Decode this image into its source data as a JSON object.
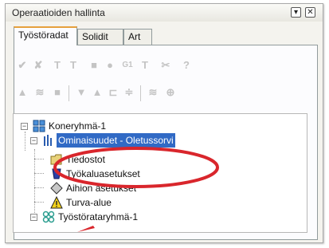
{
  "window": {
    "title": "Operaatioiden hallinta"
  },
  "tabs": [
    {
      "label": "Työstöradat"
    },
    {
      "label": "Solidit"
    },
    {
      "label": "Art"
    }
  ],
  "tree": {
    "group1": {
      "label": "Koneryhmä-1"
    },
    "properties": {
      "label": "Ominaisuudet - Oletussorvi"
    },
    "children": [
      {
        "label": "Tiedostot"
      },
      {
        "label": "Työkaluasetukset"
      },
      {
        "label": "Aihion asetukset"
      },
      {
        "label": "Turva-alue"
      }
    ],
    "toolpath_group": {
      "label": "Työstörataryhmä-1"
    }
  },
  "colors": {
    "selection": "#316ac5",
    "highlight_ellipse": "#d9262c",
    "tab_accent": "#e6a03c"
  }
}
